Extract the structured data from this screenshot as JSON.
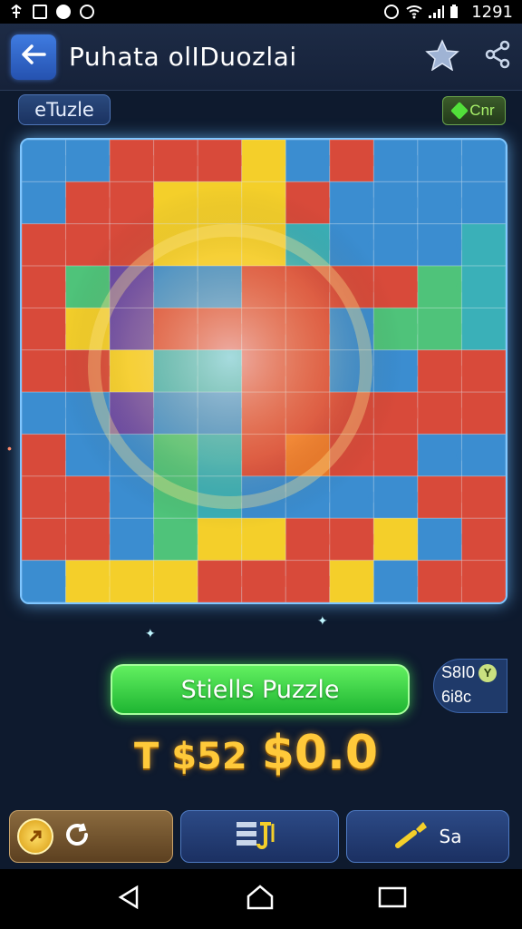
{
  "status_bar": {
    "time": "1291",
    "left_icons": [
      "usb-icon",
      "image-icon",
      "shield-icon",
      "sync-icon"
    ],
    "right_icons": [
      "alarm-icon",
      "wifi-icon",
      "signal-icon",
      "battery-icon"
    ]
  },
  "app_bar": {
    "title": "Puhata olIDuozlai",
    "back_icon": "arrow-left-icon",
    "actions": [
      "star-icon",
      "share-icon"
    ]
  },
  "chips": {
    "left_label": "eTuzle",
    "right_label": "Cnr"
  },
  "board": {
    "colors": {
      "red": "#d84a3a",
      "blue": "#3b8dd0",
      "yellow": "#f4cf2a",
      "green": "#4fc37a",
      "purple": "#6b4aa8",
      "teal": "#3ab0b8",
      "orange": "#ee7a2a"
    }
  },
  "action": {
    "main_button": "Stiells Puzzle",
    "side_badge_top": "S8I0",
    "side_badge_coin": "Y",
    "side_badge_bottom": "6i8c"
  },
  "score": {
    "left": "T $52",
    "right": "$0.0"
  },
  "toolbar": {
    "button1_icon": "coin-icon",
    "button1_label": "",
    "button2_label": "",
    "button3_label": "Sa"
  },
  "colors": {
    "accent_green": "#2ed048",
    "gold": "#ffc93a",
    "primary_blue": "#2552b0"
  }
}
